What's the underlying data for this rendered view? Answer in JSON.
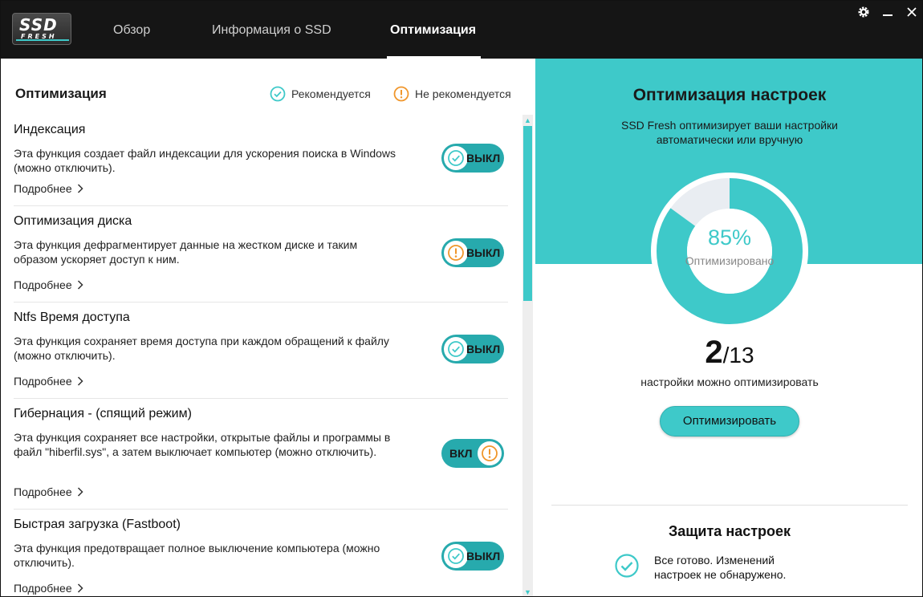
{
  "app": {
    "logo_top": "SSD",
    "logo_bottom": "FRESH",
    "tabs": [
      {
        "label": "Обзор",
        "active": false
      },
      {
        "label": "Информация о SSD",
        "active": false
      },
      {
        "label": "Оптимизация",
        "active": true
      }
    ],
    "window_controls": {
      "settings": "gear-icon",
      "minimize": "minimize-icon",
      "close": "close-icon"
    }
  },
  "left": {
    "title": "Оптимизация",
    "legend": {
      "recommended": "Рекомендуется",
      "not_recommended": "Не рекомендуется"
    },
    "items": [
      {
        "title": "Индексация",
        "desc": "Эта функция создает файл индексации для ускорения поиска в Windows (можно отключить).",
        "more": "Подробнее",
        "toggle": "ВЫКЛ",
        "state": "off",
        "status": "recommended"
      },
      {
        "title": "Оптимизация диска",
        "desc": "Эта функция дефрагментирует данные на жестком диске и таким образом ускоряет доступ к ним.",
        "more": "Подробнее",
        "toggle": "ВЫКЛ",
        "state": "off",
        "status": "not-recommended"
      },
      {
        "title": "Ntfs Время доступа",
        "desc": "Эта функция сохраняет время доступа при каждом обращений к файлу (можно отключить).",
        "more": "Подробнее",
        "toggle": "ВЫКЛ",
        "state": "off",
        "status": "recommended"
      },
      {
        "title": "Гибернация - (спящий режим)",
        "desc": "Эта функция сохраняет все настройки, открытые файлы и программы в файл \"hiberfil.sys\", а затем выключает компьютер (можно отключить).",
        "more": "Подробнее",
        "toggle": "ВКЛ",
        "state": "on",
        "status": "not-recommended"
      },
      {
        "title": "Быстрая загрузка (Fastboot)",
        "desc": "Эта функция предотвращает полное выключение компьютера (можно отключить).",
        "more": "Подробнее",
        "toggle": "ВЫКЛ",
        "state": "off",
        "status": "recommended"
      }
    ]
  },
  "right": {
    "title": "Оптимизация настроек",
    "subtitle": "SSD Fresh оптимизирует ваши настройки автоматически или вручную",
    "gauge": {
      "percent_text": "85%",
      "percent_value": 85,
      "label": "Оптимизировано"
    },
    "count": {
      "current": "2",
      "total": "/13",
      "label": "настройки можно оптимизировать"
    },
    "optimize_button": "Оптимизировать",
    "protection": {
      "title": "Защита настроек",
      "text": "Все готово. Изменений настроек не обнаружено."
    }
  },
  "colors": {
    "accent": "#3ec9c9",
    "toggle": "#27aaad",
    "warning": "#f0962b",
    "topbar": "#151515"
  }
}
